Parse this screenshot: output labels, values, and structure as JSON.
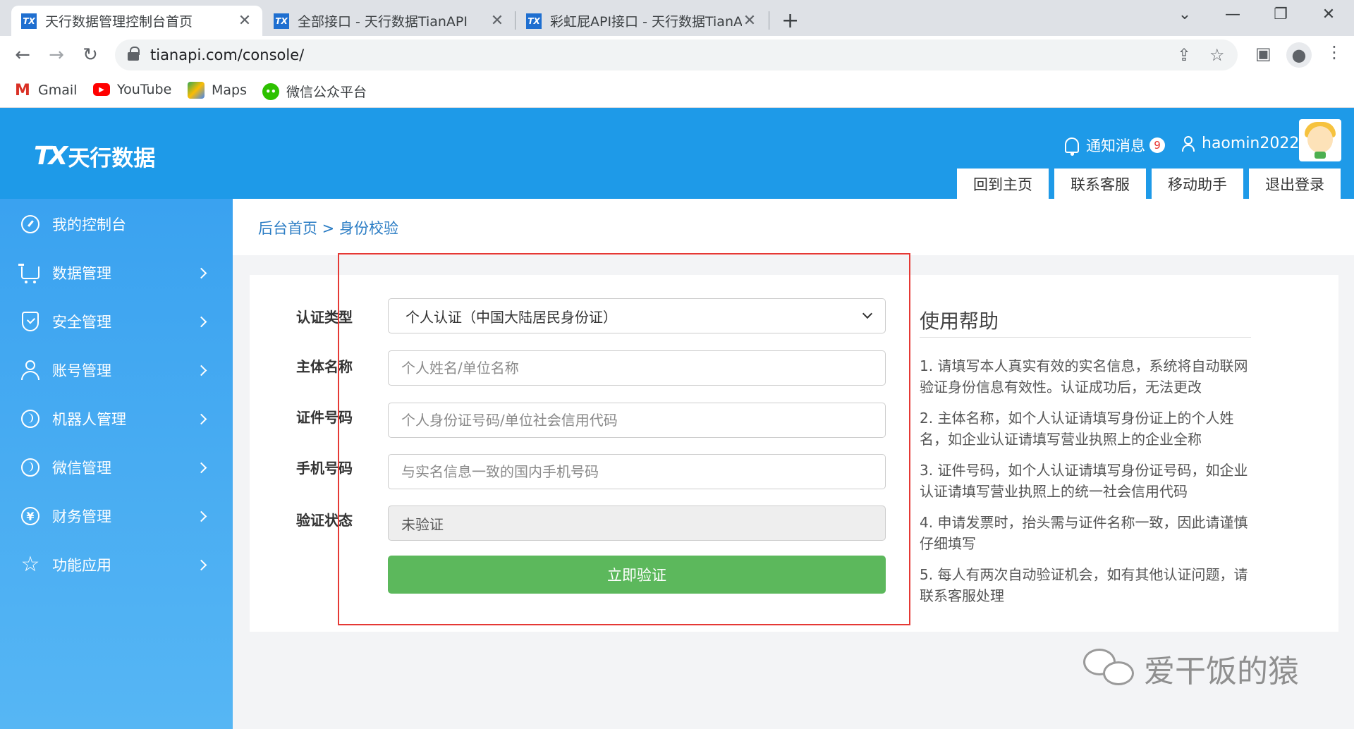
{
  "browser": {
    "tabs": [
      {
        "title": "天行数据管理控制台首页",
        "active": true
      },
      {
        "title": "全部接口 - 天行数据TianAPI",
        "active": false
      },
      {
        "title": "彩虹屁API接口 - 天行数据TianA",
        "active": false
      }
    ],
    "favicon_text": "TX",
    "url": "tianapi.com/console/",
    "bookmarks": [
      {
        "label": "Gmail",
        "icon": "gmail-icon"
      },
      {
        "label": "YouTube",
        "icon": "youtube-icon"
      },
      {
        "label": "Maps",
        "icon": "maps-icon"
      },
      {
        "label": "微信公众平台",
        "icon": "wechat-icon"
      }
    ]
  },
  "header": {
    "logo_mark": "TX",
    "logo_text": "天行数据",
    "notice_label": "通知消息",
    "notice_count": "9",
    "username": "haomin2022",
    "buttons": [
      "回到主页",
      "联系客服",
      "移动助手",
      "退出登录"
    ],
    "brand_color": "#1e9ae8"
  },
  "sidebar": {
    "items": [
      {
        "label": "我的控制台",
        "icon": "dashboard-icon",
        "has_arrow": false
      },
      {
        "label": "数据管理",
        "icon": "cart-icon",
        "has_arrow": true
      },
      {
        "label": "安全管理",
        "icon": "shield-icon",
        "has_arrow": true
      },
      {
        "label": "账号管理",
        "icon": "user-icon",
        "has_arrow": true
      },
      {
        "label": "机器人管理",
        "icon": "robot-icon",
        "has_arrow": true
      },
      {
        "label": "微信管理",
        "icon": "globe-icon",
        "has_arrow": true
      },
      {
        "label": "财务管理",
        "icon": "yen-icon",
        "has_arrow": true
      },
      {
        "label": "功能应用",
        "icon": "star-icon",
        "has_arrow": true
      }
    ]
  },
  "breadcrumb": "后台首页 > 身份校验",
  "form": {
    "labels": [
      "认证类型",
      "主体名称",
      "证件号码",
      "手机号码",
      "验证状态"
    ],
    "cert_type_selected": "个人认证（中国大陆居民身份证）",
    "name_placeholder": "个人姓名/单位名称",
    "id_placeholder": "个人身份证号码/单位社会信用代码",
    "phone_placeholder": "与实名信息一致的国内手机号码",
    "status_value": "未验证",
    "submit_label": "立即验证",
    "submit_color": "#5cb85c"
  },
  "help": {
    "title": "使用帮助",
    "items": [
      "1. 请填写本人真实有效的实名信息，系统将自动联网验证身份信息有效性。认证成功后，无法更改",
      "2. 主体名称，如个人认证请填写身份证上的个人姓名，如企业认证请填写营业执照上的企业全称",
      "3. 证件号码，如个人认证请填写身份证号码，如企业认证请填写营业执照上的统一社会信用代码",
      "4. 申请发票时，抬头需与证件名称一致，因此请谨慎仔细填写",
      "5. 每人有两次自动验证机会，如有其他认证问题，请联系客服处理"
    ]
  },
  "watermark": "爱干饭的猿",
  "highlight_color": "#e53935"
}
